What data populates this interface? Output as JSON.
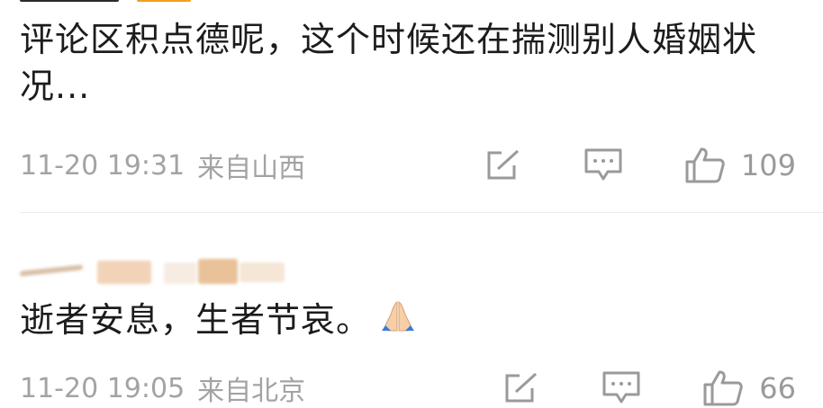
{
  "comments": [
    {
      "text": "评论区积点德呢，这个时候还在揣测别人婚姻状况...",
      "time": "11-20 19:31",
      "location": "来自山西",
      "likes": "109",
      "icons": [
        "share-icon",
        "comment-icon",
        "like-icon"
      ]
    },
    {
      "text": "逝者安息，生者节哀。",
      "emoji": "folded-hands",
      "time": "11-20 19:05",
      "location": "来自北京",
      "likes": "66",
      "icons": [
        "share-icon",
        "comment-icon",
        "like-icon"
      ]
    }
  ],
  "colors": {
    "text": "#1c1c1c",
    "meta": "#a3a3a3",
    "divider": "#ececec",
    "username_blur": [
      "#f2d8c0",
      "#e9c29a",
      "#f5e6d6"
    ]
  }
}
